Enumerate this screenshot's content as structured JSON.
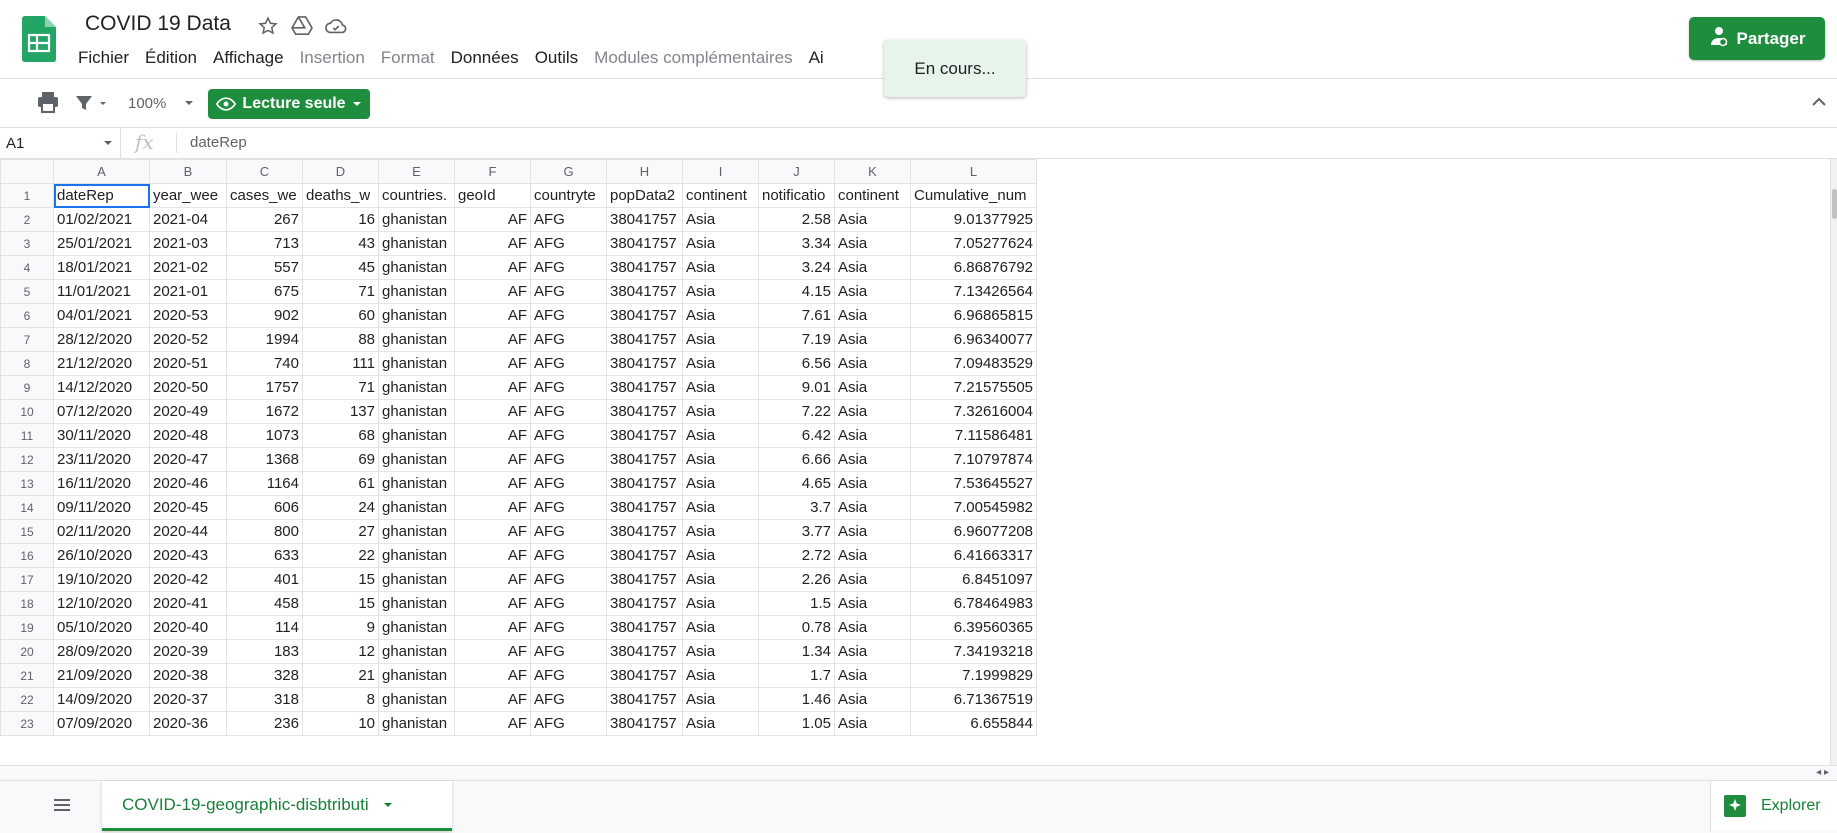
{
  "app": {
    "title": "COVID 19 Data",
    "menu": [
      {
        "label": "Fichier",
        "disabled": false
      },
      {
        "label": "Édition",
        "disabled": false
      },
      {
        "label": "Affichage",
        "disabled": false
      },
      {
        "label": "Insertion",
        "disabled": true
      },
      {
        "label": "Format",
        "disabled": true
      },
      {
        "label": "Données",
        "disabled": false
      },
      {
        "label": "Outils",
        "disabled": false
      },
      {
        "label": "Modules complémentaires",
        "disabled": true
      },
      {
        "label": "Ai",
        "disabled": false
      }
    ],
    "share_label": "Partager",
    "toast": "En cours..."
  },
  "toolbar": {
    "zoom": "100%",
    "readonly_label": "Lecture seule"
  },
  "formula": {
    "cell_ref": "A1",
    "value": "dateRep"
  },
  "grid": {
    "columns": [
      "A",
      "B",
      "C",
      "D",
      "E",
      "F",
      "G",
      "H",
      "I",
      "J",
      "K",
      "L"
    ],
    "rows": [
      [
        "dateRep",
        "year_wee",
        "cases_we",
        "deaths_w",
        "countries.",
        "geoId",
        "countryte",
        "popData2",
        "continent",
        "notificatio",
        "continent",
        "Cumulative_num"
      ],
      [
        "01/02/2021",
        "2021-04",
        "267",
        "16",
        "ghanistan",
        "AF",
        "AFG",
        "38041757",
        "Asia",
        "2.58",
        "Asia",
        "9.01377925"
      ],
      [
        "25/01/2021",
        "2021-03",
        "713",
        "43",
        "ghanistan",
        "AF",
        "AFG",
        "38041757",
        "Asia",
        "3.34",
        "Asia",
        "7.05277624"
      ],
      [
        "18/01/2021",
        "2021-02",
        "557",
        "45",
        "ghanistan",
        "AF",
        "AFG",
        "38041757",
        "Asia",
        "3.24",
        "Asia",
        "6.86876792"
      ],
      [
        "11/01/2021",
        "2021-01",
        "675",
        "71",
        "ghanistan",
        "AF",
        "AFG",
        "38041757",
        "Asia",
        "4.15",
        "Asia",
        "7.13426564"
      ],
      [
        "04/01/2021",
        "2020-53",
        "902",
        "60",
        "ghanistan",
        "AF",
        "AFG",
        "38041757",
        "Asia",
        "7.61",
        "Asia",
        "6.96865815"
      ],
      [
        "28/12/2020",
        "2020-52",
        "1994",
        "88",
        "ghanistan",
        "AF",
        "AFG",
        "38041757",
        "Asia",
        "7.19",
        "Asia",
        "6.96340077"
      ],
      [
        "21/12/2020",
        "2020-51",
        "740",
        "111",
        "ghanistan",
        "AF",
        "AFG",
        "38041757",
        "Asia",
        "6.56",
        "Asia",
        "7.09483529"
      ],
      [
        "14/12/2020",
        "2020-50",
        "1757",
        "71",
        "ghanistan",
        "AF",
        "AFG",
        "38041757",
        "Asia",
        "9.01",
        "Asia",
        "7.21575505"
      ],
      [
        "07/12/2020",
        "2020-49",
        "1672",
        "137",
        "ghanistan",
        "AF",
        "AFG",
        "38041757",
        "Asia",
        "7.22",
        "Asia",
        "7.32616004"
      ],
      [
        "30/11/2020",
        "2020-48",
        "1073",
        "68",
        "ghanistan",
        "AF",
        "AFG",
        "38041757",
        "Asia",
        "6.42",
        "Asia",
        "7.11586481"
      ],
      [
        "23/11/2020",
        "2020-47",
        "1368",
        "69",
        "ghanistan",
        "AF",
        "AFG",
        "38041757",
        "Asia",
        "6.66",
        "Asia",
        "7.10797874"
      ],
      [
        "16/11/2020",
        "2020-46",
        "1164",
        "61",
        "ghanistan",
        "AF",
        "AFG",
        "38041757",
        "Asia",
        "4.65",
        "Asia",
        "7.53645527"
      ],
      [
        "09/11/2020",
        "2020-45",
        "606",
        "24",
        "ghanistan",
        "AF",
        "AFG",
        "38041757",
        "Asia",
        "3.7",
        "Asia",
        "7.00545982"
      ],
      [
        "02/11/2020",
        "2020-44",
        "800",
        "27",
        "ghanistan",
        "AF",
        "AFG",
        "38041757",
        "Asia",
        "3.77",
        "Asia",
        "6.96077208"
      ],
      [
        "26/10/2020",
        "2020-43",
        "633",
        "22",
        "ghanistan",
        "AF",
        "AFG",
        "38041757",
        "Asia",
        "2.72",
        "Asia",
        "6.41663317"
      ],
      [
        "19/10/2020",
        "2020-42",
        "401",
        "15",
        "ghanistan",
        "AF",
        "AFG",
        "38041757",
        "Asia",
        "2.26",
        "Asia",
        "6.8451097"
      ],
      [
        "12/10/2020",
        "2020-41",
        "458",
        "15",
        "ghanistan",
        "AF",
        "AFG",
        "38041757",
        "Asia",
        "1.5",
        "Asia",
        "6.78464983"
      ],
      [
        "05/10/2020",
        "2020-40",
        "114",
        "9",
        "ghanistan",
        "AF",
        "AFG",
        "38041757",
        "Asia",
        "0.78",
        "Asia",
        "6.39560365"
      ],
      [
        "28/09/2020",
        "2020-39",
        "183",
        "12",
        "ghanistan",
        "AF",
        "AFG",
        "38041757",
        "Asia",
        "1.34",
        "Asia",
        "7.34193218"
      ],
      [
        "21/09/2020",
        "2020-38",
        "328",
        "21",
        "ghanistan",
        "AF",
        "AFG",
        "38041757",
        "Asia",
        "1.7",
        "Asia",
        "7.1999829"
      ],
      [
        "14/09/2020",
        "2020-37",
        "318",
        "8",
        "ghanistan",
        "AF",
        "AFG",
        "38041757",
        "Asia",
        "1.46",
        "Asia",
        "6.71367519"
      ],
      [
        "07/09/2020",
        "2020-36",
        "236",
        "10",
        "ghanistan",
        "AF",
        "AFG",
        "38041757",
        "Asia",
        "1.05",
        "Asia",
        "6.655844"
      ]
    ],
    "numeric_columns": [
      2,
      3,
      5,
      9,
      11
    ]
  },
  "sheets": {
    "active": "COVID-19-geographic-disbtributi",
    "explore_label": "Explorer"
  },
  "colors": {
    "accent": "#1e8e3e",
    "selection": "#1a73e8"
  },
  "icons": [
    "sheets-logo-icon",
    "star-icon",
    "move-to-drive-icon",
    "cloud-status-icon",
    "share-person-icon",
    "print-icon",
    "filter-icon",
    "eye-icon",
    "collapse-chevron-icon",
    "all-sheets-icon",
    "explore-icon"
  ]
}
